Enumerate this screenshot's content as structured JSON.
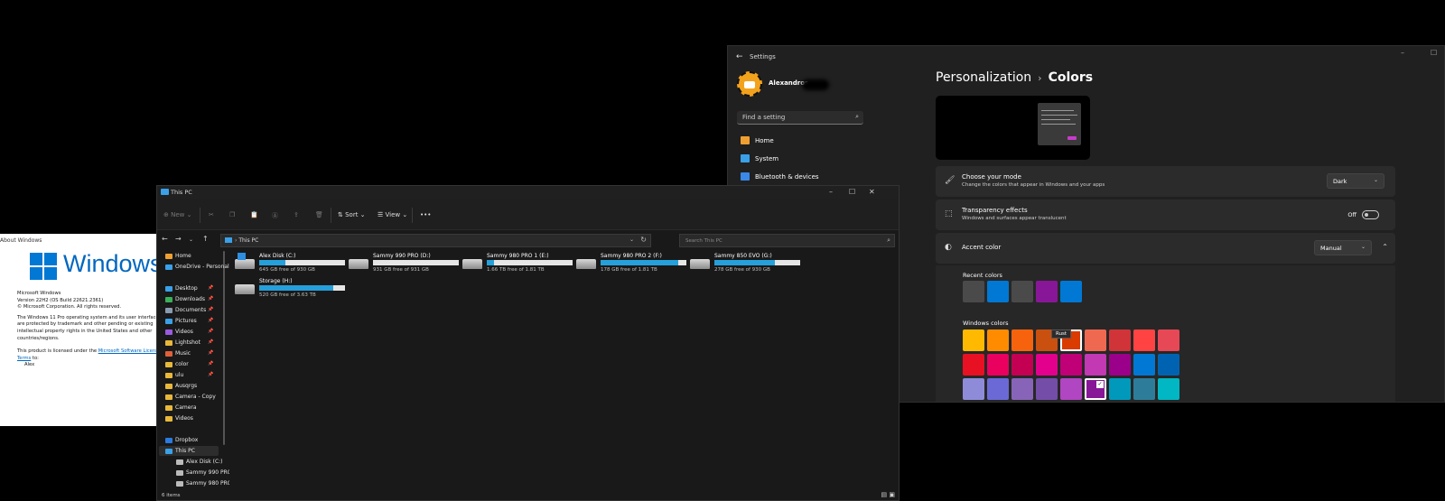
{
  "about": {
    "title": "About Windows",
    "wordmark": "Windows",
    "line1": "Microsoft Windows",
    "line2": "Version 22H2 (OS Build 22621.2361)",
    "line3": "© Microsoft Corporation. All rights reserved.",
    "para": "The Windows 11 Pro operating system and its user interface are protected by trademark and other pending or existing intellectual property rights in the United States and other countries/regions.",
    "license_prefix": "This product is licensed under the ",
    "license_link": "Microsoft Software License Terms",
    "license_suffix": " to:",
    "licensee": "Alex",
    "colors": {
      "brand": "#0078d4"
    }
  },
  "settings": {
    "app_title": "Settings",
    "user_name": "Alexandros",
    "search_placeholder": "Find a setting",
    "nav": [
      {
        "label": "Home",
        "icon": "home-icon",
        "color": "#f0a030"
      },
      {
        "label": "System",
        "icon": "monitor-icon",
        "color": "#3aa0e8"
      },
      {
        "label": "Bluetooth & devices",
        "icon": "bluetooth-icon",
        "color": "#3a88e8"
      }
    ],
    "breadcrumb_parent": "Personalization",
    "breadcrumb_current": "Colors",
    "mode": {
      "title": "Choose your mode",
      "desc": "Change the colors that appear in Windows and your apps",
      "value": "Dark"
    },
    "transparency": {
      "title": "Transparency effects",
      "desc": "Windows and surfaces appear translucent",
      "state": "Off"
    },
    "accent": {
      "title": "Accent color",
      "value": "Manual"
    },
    "recent_label": "Recent colors",
    "recent_colors": [
      "#4a4a4a",
      "#0078d4",
      "#4a4a4a",
      "#881798",
      "#0078d4"
    ],
    "windows_label": "Windows colors",
    "tooltip": "Rust",
    "windows_colors": [
      [
        "#ffb900",
        "#ff8c00",
        "#f7630c",
        "#ca5010",
        "#da3b01",
        "#ef6950",
        "#d13438",
        "#ff4343",
        "#e74856"
      ],
      [
        "#e81123",
        "#ea005e",
        "#c30052",
        "#e3008c",
        "#bf0077",
        "#c239b3",
        "#9a0089",
        "#0078d4",
        "#0063b1"
      ],
      [
        "#8e8cd8",
        "#6b69d6",
        "#8764b8",
        "#744da9",
        "#b146c2",
        "#881798",
        "#0099bc",
        "#2d7d9a",
        "#00b7c3"
      ]
    ],
    "selected": {
      "row": 2,
      "col": 5
    },
    "tooltip_index": {
      "row": 0,
      "col": 4
    }
  },
  "explorer": {
    "title": "This PC",
    "toolbar": {
      "new_label": "New",
      "sort_label": "Sort",
      "view_label": "View",
      "more_label": "•••"
    },
    "address": "This PC",
    "search_placeholder": "Search This PC",
    "sidebar": [
      {
        "label": "Home",
        "icon": "home-icon",
        "color": "#f0a030",
        "pinned": false
      },
      {
        "label": "OneDrive - Personal",
        "icon": "cloud-icon",
        "color": "#3aa0e8",
        "pinned": false
      },
      {
        "label": "Desktop",
        "icon": "desktop-icon",
        "color": "#3aa0e8",
        "pinned": true
      },
      {
        "label": "Downloads",
        "icon": "download-icon",
        "color": "#3ab05a",
        "pinned": true
      },
      {
        "label": "Documents",
        "icon": "document-icon",
        "color": "#8a9ab0",
        "pinned": true
      },
      {
        "label": "Pictures",
        "icon": "picture-icon",
        "color": "#3aa0e8",
        "pinned": true
      },
      {
        "label": "Videos",
        "icon": "video-icon",
        "color": "#9a5ae0",
        "pinned": true
      },
      {
        "label": "Lightshot",
        "icon": "folder-icon",
        "color": "#e8b83a",
        "pinned": true
      },
      {
        "label": "Music",
        "icon": "music-icon",
        "color": "#e0603a",
        "pinned": true
      },
      {
        "label": "color",
        "icon": "folder-icon",
        "color": "#e8b83a",
        "pinned": true
      },
      {
        "label": "ulu",
        "icon": "folder-icon",
        "color": "#e8b83a",
        "pinned": true
      },
      {
        "label": "Ausqrgs",
        "icon": "folder-icon",
        "color": "#e8b83a",
        "pinned": false
      },
      {
        "label": "Camera - Copy",
        "icon": "folder-icon",
        "color": "#e8b83a",
        "pinned": false
      },
      {
        "label": "Camera",
        "icon": "folder-icon",
        "color": "#e8b83a",
        "pinned": false
      },
      {
        "label": "Videos",
        "icon": "folder-icon",
        "color": "#e8b83a",
        "pinned": false
      },
      {
        "label": "Dropbox",
        "icon": "dropbox-icon",
        "color": "#2a7ae0",
        "pinned": false
      },
      {
        "label": "This PC",
        "icon": "pc-icon",
        "color": "#3aa0e8",
        "pinned": false
      },
      {
        "label": "Alex Disk (C:)",
        "icon": "drive-icon",
        "color": "#bbbbbb",
        "pinned": false
      },
      {
        "label": "Sammy 990 PRO",
        "icon": "drive-icon",
        "color": "#bbbbbb",
        "pinned": false
      },
      {
        "label": "Sammy 980 PRO",
        "icon": "drive-icon",
        "color": "#bbbbbb",
        "pinned": false
      }
    ],
    "drives": [
      {
        "name": "Alex Disk (C:)",
        "free": "645 GB free of 930 GB",
        "used": 0.31,
        "system": true
      },
      {
        "name": "Sammy 990 PRO (D:)",
        "free": "931 GB free of 931 GB",
        "used": 0.0,
        "system": false
      },
      {
        "name": "Sammy 980 PRO 1 (E:)",
        "free": "1.66 TB free of 1.81 TB",
        "used": 0.08,
        "system": false
      },
      {
        "name": "Sammy 980 PRO 2 (F:)",
        "free": "178 GB free of 1.81 TB",
        "used": 0.9,
        "system": false
      },
      {
        "name": "Sammy 850 EVO (G:)",
        "free": "278 GB free of 930 GB",
        "used": 0.7,
        "system": false
      },
      {
        "name": "Storage (H:)",
        "free": "520 GB free of 3.63 TB",
        "used": 0.86,
        "system": false
      }
    ],
    "status": "6 items"
  }
}
